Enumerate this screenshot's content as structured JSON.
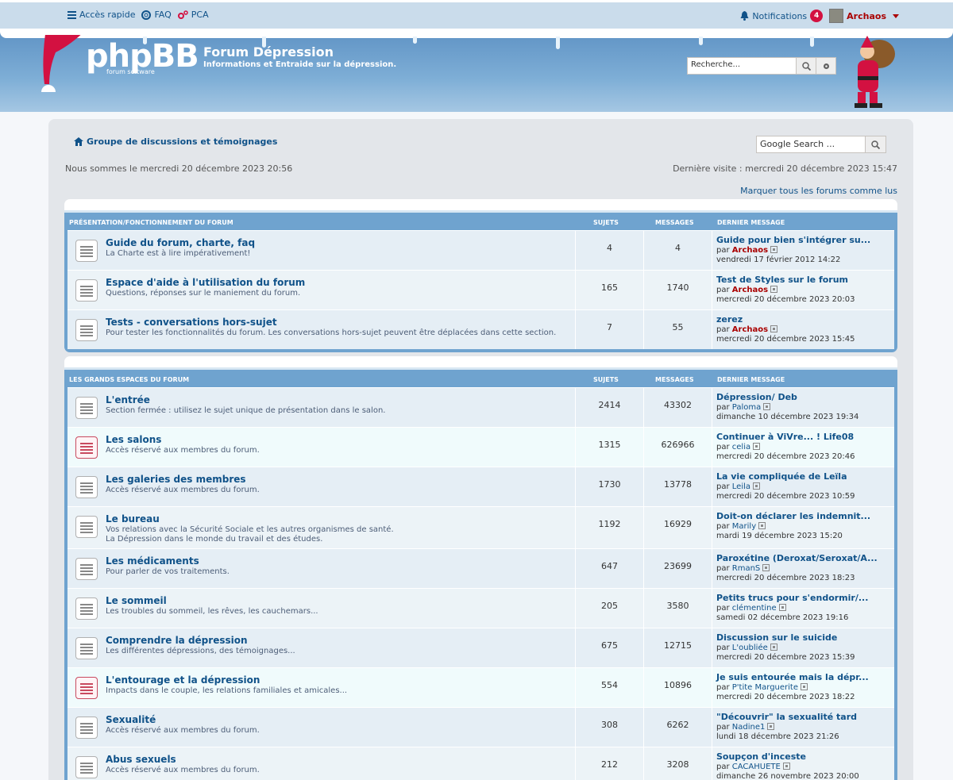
{
  "topbar": {
    "quick_access": "Accès rapide",
    "faq": "FAQ",
    "pca": "PCA",
    "notifications": "Notifications",
    "notif_count": "4",
    "username": "Archaos"
  },
  "header": {
    "logo": "phpBB",
    "logo_sub": "forum        software",
    "site_title": "Forum Dépression",
    "site_desc": "Informations et Entraide sur la dépression.",
    "search_placeholder": "Recherche..."
  },
  "main": {
    "breadcrumb": "Groupe de discussions et témoignages",
    "google_search": "Google Search ...",
    "now": "Nous sommes le mercredi 20 décembre 2023 20:56",
    "last_visit": "Dernière visite : mercredi 20 décembre 2023 15:47",
    "mark_read": "Marquer tous les forums comme lus"
  },
  "columns": {
    "sujets": "SUJETS",
    "messages": "MESSAGES",
    "last": "DERNIER MESSAGE"
  },
  "categories": [
    {
      "name": "PRÉSENTATION/FONCTIONNEMENT DU FORUM",
      "forums": [
        {
          "title": "Guide du forum, charte, faq",
          "desc": "La Charte est à lire impérativement!",
          "desc2": "",
          "topics": "4",
          "posts": "4",
          "last_title": "Guide pour bien s'intégrer su...",
          "last_by": "Archaos",
          "by_color": "#aa0000",
          "last_date": "vendredi 17 février 2012 14:22",
          "unread": false
        },
        {
          "title": "Espace d'aide à l'utilisation du forum",
          "desc": "Questions, réponses sur le maniement du forum.",
          "desc2": "",
          "topics": "165",
          "posts": "1740",
          "last_title": "Test de Styles sur le forum",
          "last_by": "Archaos",
          "by_color": "#aa0000",
          "last_date": "mercredi 20 décembre 2023 20:03",
          "unread": false
        },
        {
          "title": "Tests - conversations hors-sujet",
          "desc": "Pour tester les fonctionnalités du forum. Les conversations hors-sujet peuvent être déplacées dans cette section.",
          "desc2": "",
          "topics": "7",
          "posts": "55",
          "last_title": "zerez",
          "last_by": "Archaos",
          "by_color": "#aa0000",
          "last_date": "mercredi 20 décembre 2023 15:45",
          "unread": false
        }
      ]
    },
    {
      "name": "LES GRANDS ESPACES DU FORUM",
      "forums": [
        {
          "title": "L'entrée",
          "desc": "Section fermée : utilisez le sujet unique de présentation dans le salon.",
          "desc2": "",
          "topics": "2414",
          "posts": "43302",
          "last_title": "Dépression/ Deb",
          "last_by": "Paloma",
          "by_color": "#105289",
          "last_date": "dimanche 10 décembre 2023 19:34",
          "unread": false
        },
        {
          "title": "Les salons",
          "desc": "Accès réservé aux membres du forum.",
          "desc2": "",
          "topics": "1315",
          "posts": "626966",
          "last_title": "Continuer à ViVre... ! Life08",
          "last_by": "celia",
          "by_color": "#105289",
          "last_date": "mercredi 20 décembre 2023 20:46",
          "unread": true
        },
        {
          "title": "Les galeries des membres",
          "desc": "Accès réservé aux membres du forum.",
          "desc2": "",
          "topics": "1730",
          "posts": "13778",
          "last_title": "La vie compliquée de Leïla",
          "last_by": "Leila",
          "by_color": "#105289",
          "last_date": "mercredi 20 décembre 2023 10:59",
          "unread": false
        },
        {
          "title": "Le bureau",
          "desc": "Vos relations avec la Sécurité Sociale et les autres organismes de santé.",
          "desc2": "La Dépression dans le monde du travail et des études.",
          "topics": "1192",
          "posts": "16929",
          "last_title": "Doit-on déclarer les indemnit...",
          "last_by": "Marily",
          "by_color": "#105289",
          "last_date": "mardi 19 décembre 2023 15:20",
          "unread": false
        },
        {
          "title": "Les médicaments",
          "desc": "Pour parler de vos traitements.",
          "desc2": "",
          "topics": "647",
          "posts": "23699",
          "last_title": "Paroxétine (Deroxat/Seroxat/A...",
          "last_by": "RmanS",
          "by_color": "#105289",
          "last_date": "mercredi 20 décembre 2023 18:23",
          "unread": false
        },
        {
          "title": "Le sommeil",
          "desc": "Les troubles du sommeil, les rêves, les cauchemars...",
          "desc2": "",
          "topics": "205",
          "posts": "3580",
          "last_title": "Petits trucs pour s'endormir/...",
          "last_by": "clémentine",
          "by_color": "#105289",
          "last_date": "samedi 02 décembre 2023 19:16",
          "unread": false
        },
        {
          "title": "Comprendre la dépression",
          "desc": "Les différentes dépressions, des témoignages...",
          "desc2": "",
          "topics": "675",
          "posts": "12715",
          "last_title": "Discussion sur le suicide",
          "last_by": "L'oubliée",
          "by_color": "#105289",
          "last_date": "mercredi 20 décembre 2023 15:39",
          "unread": false
        },
        {
          "title": "L'entourage et la dépression",
          "desc": "Impacts dans le couple, les relations familiales et amicales...",
          "desc2": "",
          "topics": "554",
          "posts": "10896",
          "last_title": "Je suis entourée mais la dépr...",
          "last_by": "P'tite Marguerite",
          "by_color": "#105289",
          "last_date": "mercredi 20 décembre 2023 18:22",
          "unread": true
        },
        {
          "title": "Sexualité",
          "desc": "Accès réservé aux membres du forum.",
          "desc2": "",
          "topics": "308",
          "posts": "6262",
          "last_title": "\"Découvrir\" la sexualité tard",
          "last_by": "Nadine1",
          "by_color": "#105289",
          "last_date": "lundi 18 décembre 2023 21:26",
          "unread": false
        },
        {
          "title": "Abus sexuels",
          "desc": "Accès réservé aux membres du forum.",
          "desc2": "",
          "topics": "212",
          "posts": "3208",
          "last_title": "Soupçon d'inceste",
          "last_by": "CACAHUETE",
          "by_color": "#105289",
          "last_date": "dimanche 26 novembre 2023 20:00",
          "unread": false
        }
      ]
    }
  ],
  "by_prefix": "par"
}
